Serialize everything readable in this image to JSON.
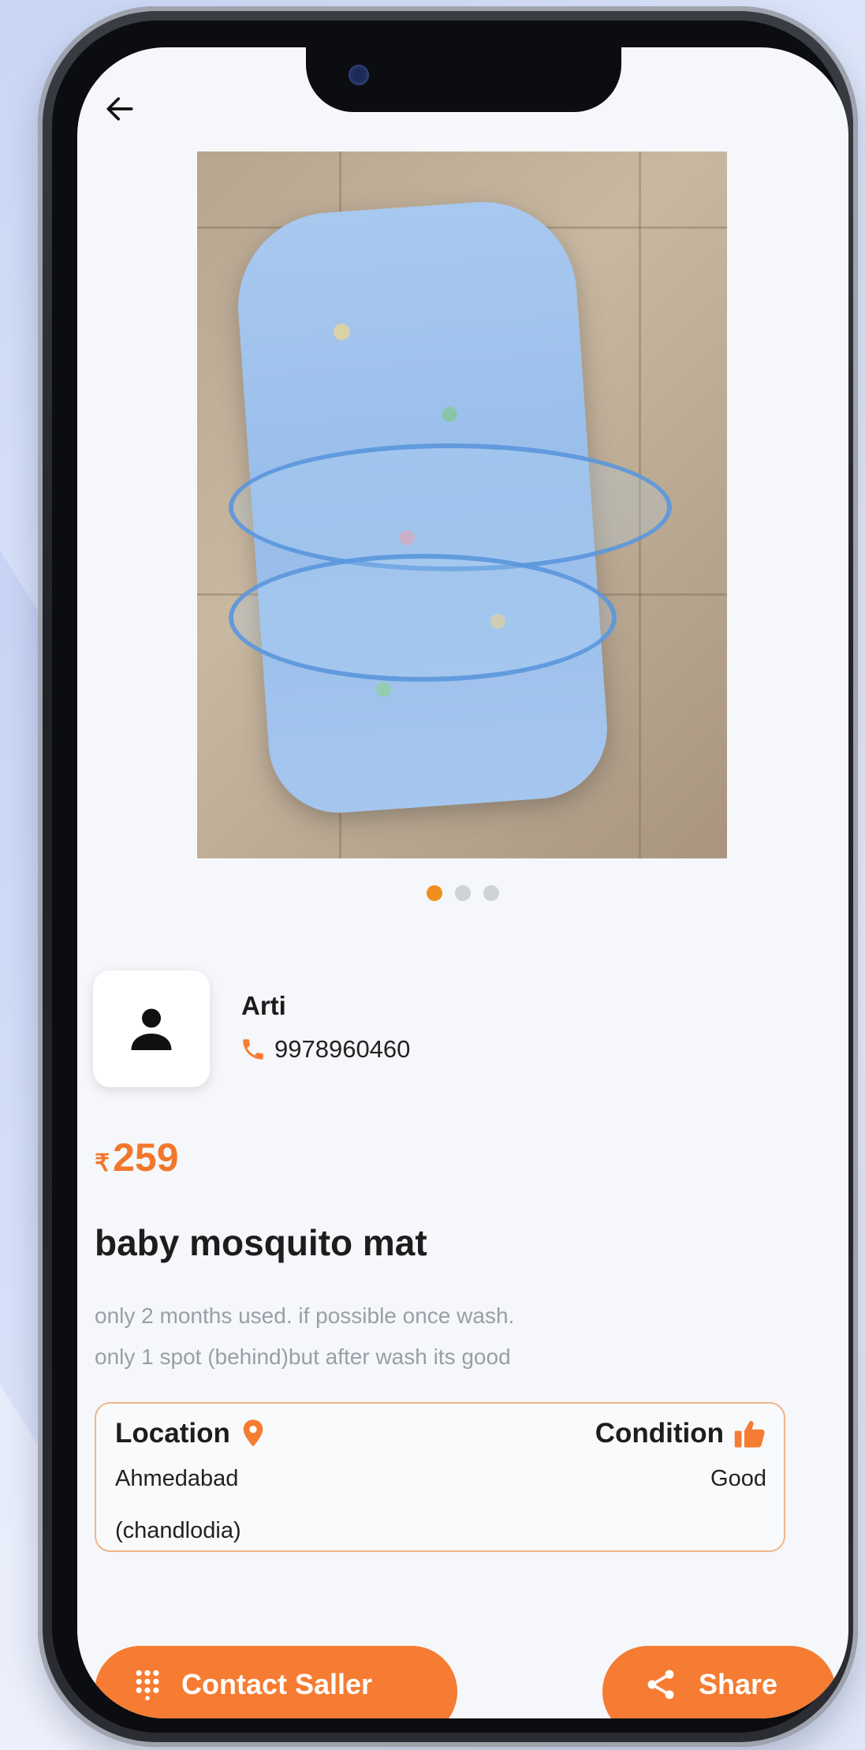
{
  "header": {
    "back_icon": "arrow-left-icon"
  },
  "gallery": {
    "total_images": 3,
    "active_index": 0
  },
  "seller": {
    "name": "Arti",
    "phone": "9978960460",
    "avatar_icon": "person-icon",
    "phone_icon": "phone-icon"
  },
  "listing": {
    "currency_symbol": "₹",
    "price": "259",
    "title": "baby mosquito mat",
    "description_line1": "only 2 months used. if possible once wash.",
    "description_line2": "only 1 spot (behind)but after wash its good"
  },
  "info": {
    "location_label": "Location",
    "location_value_line1": "Ahmedabad",
    "location_value_line2": "(chandlodia)",
    "location_icon": "map-pin-icon",
    "condition_label": "Condition",
    "condition_value": "Good",
    "condition_icon": "thumbs-up-icon"
  },
  "actions": {
    "contact_label": "Contact Saller",
    "contact_icon": "dialpad-icon",
    "share_label": "Share",
    "share_icon": "share-icon"
  },
  "colors": {
    "accent": "#f57c32",
    "dot_active": "#f08f1e",
    "dot_inactive": "#cfd3d8",
    "border_accent": "#f0b58a"
  }
}
